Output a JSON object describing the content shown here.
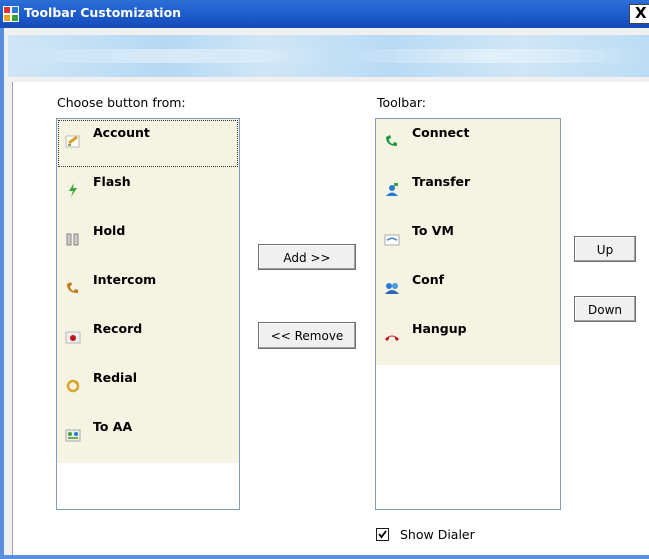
{
  "window": {
    "title": "Toolbar Customization",
    "close_glyph": "X"
  },
  "left_list": {
    "label": "Choose button from:",
    "items": [
      {
        "label": "Account",
        "icon": "account-icon"
      },
      {
        "label": "Flash",
        "icon": "flash-icon"
      },
      {
        "label": "Hold",
        "icon": "hold-icon"
      },
      {
        "label": "Intercom",
        "icon": "intercom-icon"
      },
      {
        "label": "Record",
        "icon": "record-icon"
      },
      {
        "label": "Redial",
        "icon": "redial-icon"
      },
      {
        "label": "To AA",
        "icon": "to-aa-icon"
      }
    ],
    "selected_index": 0
  },
  "right_list": {
    "label": "Toolbar:",
    "items": [
      {
        "label": "Connect",
        "icon": "connect-icon"
      },
      {
        "label": "Transfer",
        "icon": "transfer-icon"
      },
      {
        "label": "To VM",
        "icon": "voicemail-icon"
      },
      {
        "label": "Conf",
        "icon": "conference-icon"
      },
      {
        "label": "Hangup",
        "icon": "hangup-icon"
      }
    ]
  },
  "buttons": {
    "add": "Add >>",
    "remove": "<< Remove",
    "up": "Up",
    "down": "Down"
  },
  "show_dialer": {
    "label": "Show Dialer",
    "checked": true
  },
  "colors": {
    "list_background": "#f5f3e1",
    "title_bar": "#1e5fcf",
    "banner": "#cfe6f7"
  }
}
